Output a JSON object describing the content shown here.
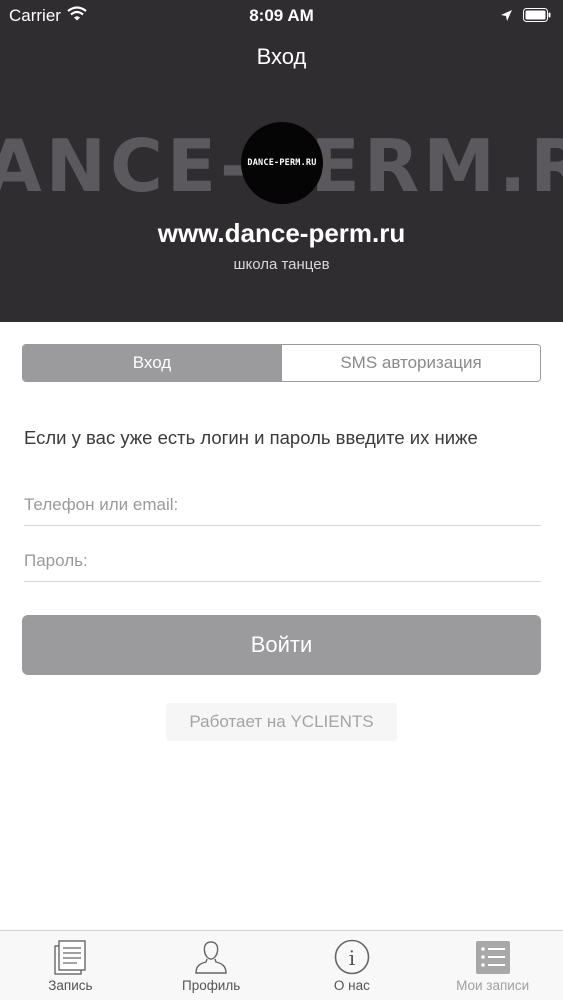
{
  "status_bar": {
    "carrier": "Carrier",
    "time": "8:09 AM"
  },
  "nav": {
    "title": "Вход"
  },
  "brand": {
    "watermark": "ANCE-PERM.RU",
    "logo_text": "DANCE-PERM.RU",
    "site_title": "www.dance-perm.ru",
    "subtitle": "школа танцев"
  },
  "segments": [
    {
      "label": "Вход",
      "active": true
    },
    {
      "label": "SMS авторизация",
      "active": false
    }
  ],
  "form": {
    "hint": "Если у вас уже есть логин и пароль введите их ниже",
    "login_placeholder": "Телефон или email:",
    "password_placeholder": "Пароль:",
    "submit_label": "Войти"
  },
  "powered_by": "Работает на YCLIENTS",
  "tabs": [
    {
      "label": "Запись",
      "icon": "document-icon"
    },
    {
      "label": "Профиль",
      "icon": "person-icon"
    },
    {
      "label": "О нас",
      "icon": "info-icon"
    },
    {
      "label": "Мои записи",
      "icon": "list-icon"
    }
  ],
  "colors": {
    "header_bg": "#2f2d30",
    "accent_gray": "#9b9a9c"
  }
}
